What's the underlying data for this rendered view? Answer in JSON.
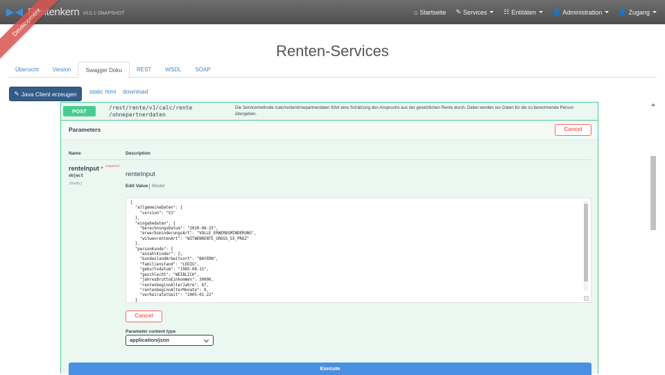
{
  "navbar": {
    "brand_name": "Rentenkern",
    "brand_version": "v0.0.1-SNAPSHOT",
    "items": [
      {
        "label": "Startseite",
        "icon": "home-icon",
        "dropdown": false
      },
      {
        "label": "Services",
        "icon": "wrench-icon",
        "dropdown": true
      },
      {
        "label": "Entitäten",
        "icon": "table-icon",
        "dropdown": true
      },
      {
        "label": "Administration",
        "icon": "user-plus-icon",
        "dropdown": true
      },
      {
        "label": "Zugang",
        "icon": "user-icon",
        "dropdown": true
      }
    ]
  },
  "ribbon": {
    "label": "Development"
  },
  "page": {
    "title": "Renten-Services"
  },
  "tabs": [
    {
      "label": "Übersicht",
      "active": false
    },
    {
      "label": "Version",
      "active": false
    },
    {
      "label": "Swagger Doku",
      "active": true
    },
    {
      "label": "REST",
      "active": false
    },
    {
      "label": "WSDL",
      "active": false
    },
    {
      "label": "SOAP",
      "active": false
    }
  ],
  "toolbar": {
    "java_client_label": "Java Client erzeugen",
    "static_html_label": "static html",
    "download_label": "download"
  },
  "operation": {
    "method": "POST",
    "path_line1": "/rest/rente/v1/calc/rente",
    "path_line2": "/ohnepartnerdaten",
    "description": "Die Servicemethode /calc/rente/ohnepartnerdaten führt eine Schätzung des Anspruchs aus der gesetzlichen Rente durch. Dabei werden nur Daten für die zu berechnende Person übergeben.",
    "parameters_title": "Parameters",
    "cancel_label": "Cancel",
    "col_name": "Name",
    "col_description": "Description",
    "param": {
      "name": "renteInput",
      "star": "*",
      "required_label": "required",
      "type": "object",
      "in": "(body)",
      "label": "renteInput"
    },
    "editor_tabs": {
      "edit": "Edit Value",
      "model": "Model"
    },
    "body_lines": [
      "{",
      "  \"allgemeineDaten\": {",
      "    \"version\": \"V1\"",
      "  },",
      "  \"eingabedaten\": {",
      "    \"berechnungsDatum\": \"2020-08-25\",",
      "    \"erwerbsminderungsArt\": \"VOLLE_ERWERBSMINDERUNG\",",
      "    \"witwenrentenArt\": \"WITWENRENTE_GROSS_55_PROZ\"",
      "  },",
      "  \"personKunde\": {",
      "    \"anzahlKinder\": 2,",
      "    \"bundeslandArbeitsort\": \"BAYERN\",",
      "    \"familienstand\": \"LEDIG\",",
      "    \"geburtsdatum\": \"1985-08-15\",",
      "    \"geschlecht\": \"WEIBLICH\",",
      "    \"jahresBruttoEinkommen\": 30000,",
      "    \"rentenbeginnAlterJahre\": 67,",
      "    \"rentenbeginnAlterMonate\": 0,",
      "    \"verheiratetSeit\": \"2005-01-22\"",
      "  }"
    ],
    "cancel_bottom_label": "Cancel",
    "content_type_label": "Parameter content type",
    "content_type_value": "application/json",
    "execute_label": "Execute"
  },
  "colors": {
    "navbar": "#5c5c5c",
    "post_green": "#49cc90",
    "opblock_bg": "#ebf8f1",
    "cancel_red": "#ff6060",
    "execute_blue": "#4990e2",
    "java_btn": "#335c87",
    "ribbon": "#d9534f"
  }
}
